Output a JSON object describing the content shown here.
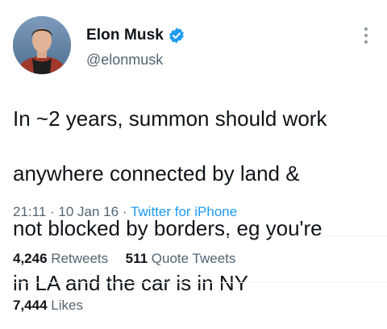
{
  "author": {
    "display_name": "Elon Musk",
    "handle": "@elonmusk",
    "verified": true
  },
  "tweet": {
    "text_lines": [
      "In ~2 years, summon should work",
      "anywhere connected by land &",
      "not blocked by borders, eg you're",
      "in LA and the car is in NY"
    ],
    "time": "21:11",
    "date": "10 Jan 16",
    "separator": "·",
    "source": "Twitter for iPhone"
  },
  "stats": {
    "retweets_count": "4,246",
    "retweets_label": "Retweets",
    "quote_count": "511",
    "quote_label": "Quote Tweets",
    "likes_count": "7,444",
    "likes_label": "Likes"
  },
  "icons": {
    "verified": "verified-badge-icon",
    "more": "more-options-icon"
  },
  "colors": {
    "accent": "#1d9bf0",
    "text_primary": "#0f1419",
    "text_secondary": "#536471",
    "divider": "#eff3f4"
  }
}
